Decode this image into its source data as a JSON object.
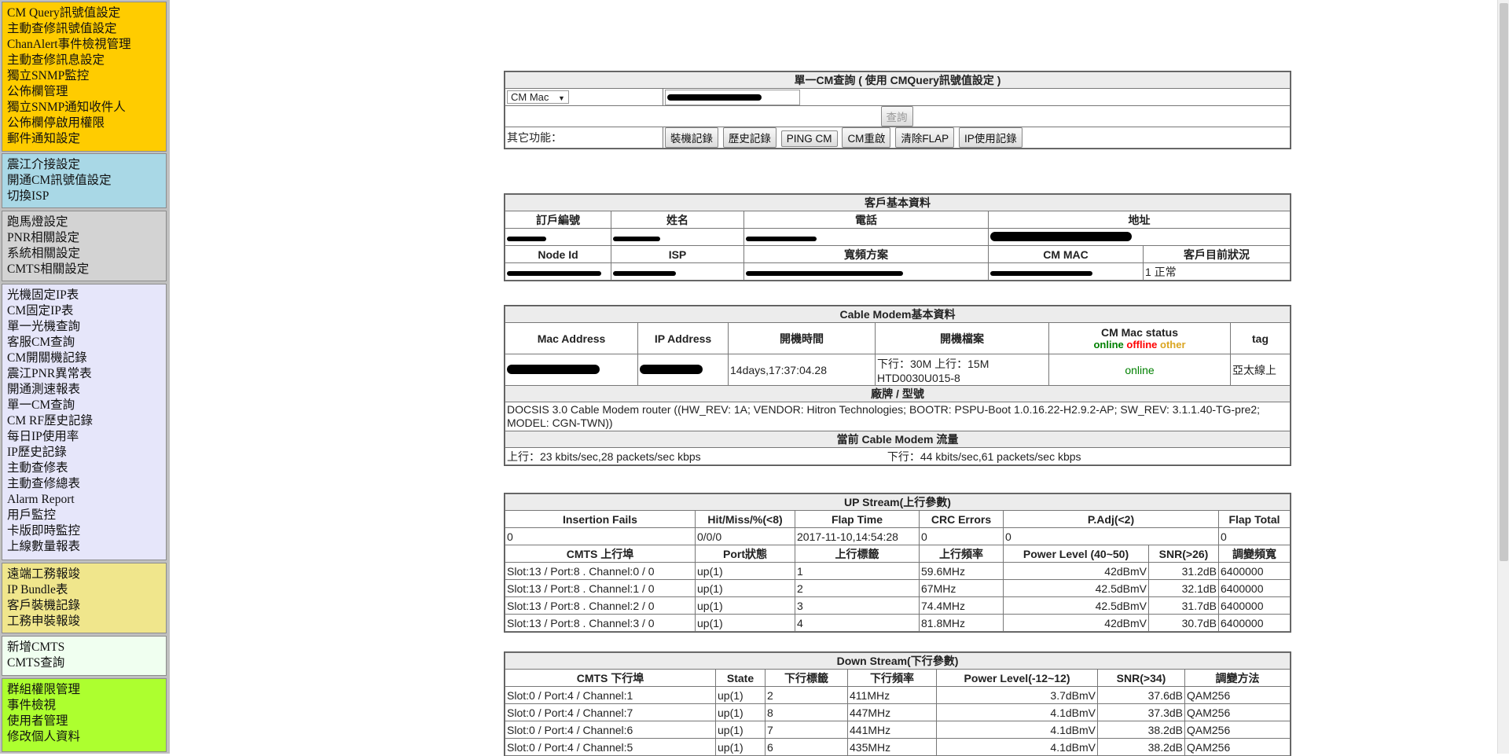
{
  "sidebar": {
    "groups": [
      {
        "items": [
          "CM Query訊號值設定",
          "主動查修訊號值設定",
          "ChanAlert事件檢視管理",
          "主動查修訊息設定",
          "獨立SNMP監控",
          "公佈欄管理",
          "獨立SNMP通知收件人",
          "公佈欄停啟用權限",
          "郵件通知設定"
        ]
      },
      {
        "items": [
          "震江介接設定",
          "開通CM訊號值設定",
          "切換ISP"
        ]
      },
      {
        "items": [
          "跑馬燈設定",
          "PNR相關設定",
          "系統相關設定",
          "CMTS相關設定"
        ]
      },
      {
        "items": [
          "光機固定IP表",
          "CM固定IP表",
          "單一光機查詢",
          "客服CM查詢",
          "CM開關機記錄",
          "震江PNR異常表",
          "開通測速報表",
          "單一CM查詢",
          "CM RF歷史記錄",
          "每日IP使用率",
          "IP歷史記錄",
          "主動查修表",
          "主動查修總表",
          "Alarm Report",
          "用戶監控",
          "卡版即時監控",
          "上線數量報表"
        ]
      },
      {
        "items": [
          "遠端工務報竣",
          "IP Bundle表",
          "客戶裝機記錄",
          "工務申裝報竣"
        ]
      },
      {
        "items": [
          "新增CMTS",
          "CMTS查詢"
        ]
      },
      {
        "items": [
          "群組權限管理",
          "事件檢視",
          "使用者管理",
          "修改個人資料"
        ]
      }
    ]
  },
  "query": {
    "title": "單一CM查詢 ( 使用 CMQuery訊號值設定 )",
    "select_value": "CM Mac",
    "search_button": "查詢",
    "other_label": "其它功能：",
    "buttons": [
      "裝機記錄",
      "歷史記錄",
      "PING CM",
      "CM重啟",
      "清除FLAP",
      "IP使用記錄"
    ]
  },
  "customer": {
    "title": "客戶基本資料",
    "headers1": [
      "訂戶編號",
      "姓名",
      "電話",
      "地址"
    ],
    "headers2": [
      "Node Id",
      "ISP",
      "寬頻方案",
      "CM MAC",
      "客戶目前狀況"
    ],
    "status": "1 正常"
  },
  "modem": {
    "title": "Cable Modem基本資料",
    "headers": [
      "Mac Address",
      "IP Address",
      "開機時間",
      "開機檔案",
      "CM Mac status",
      "tag"
    ],
    "legend": {
      "online": "online",
      "offline": "offline",
      "other": "other"
    },
    "uptime": "14days,17:37:04.28",
    "boot_file_1": "下行：30M 上行：15M",
    "boot_file_2": "HTD0030U015-8",
    "status": "online",
    "tag": "亞太線上",
    "brand_title": "廠牌 / 型號",
    "brand": "DOCSIS 3.0 Cable Modem router ((HW_REV: 1A; VENDOR: Hitron Technologies; BOOTR: PSPU-Boot 1.0.16.22-H2.9.2-AP; SW_REV: 3.1.1.40-TG-pre2; MODEL: CGN-TWN))",
    "traffic_title": "當前 Cable Modem 流量",
    "traffic_up": "上行：23 kbits/sec,28 packets/sec kbps",
    "traffic_down": "下行：44 kbits/sec,61 packets/sec kbps"
  },
  "upstream": {
    "title": "UP Stream(上行參數)",
    "headers1": [
      "Insertion Fails",
      "Hit/Miss/%(<8)",
      "Flap Time",
      "CRC Errors",
      "P.Adj(<2)",
      "Flap Total"
    ],
    "values1": [
      "0",
      "0/0/0",
      "2017-11-10,14:54:28",
      "0",
      "0",
      "0"
    ],
    "headers2": [
      "CMTS 上行埠",
      "Port狀態",
      "上行標籤",
      "上行頻率",
      "Power Level (40~50)",
      "SNR(>26)",
      "調變頻寬"
    ],
    "rows": [
      [
        "Slot:13 / Port:8 . Channel:0 / 0",
        "up(1)",
        "1",
        "59.6MHz",
        "42dBmV",
        "31.2dB",
        "6400000"
      ],
      [
        "Slot:13 / Port:8 . Channel:1 / 0",
        "up(1)",
        "2",
        "67MHz",
        "42.5dBmV",
        "32.1dB",
        "6400000"
      ],
      [
        "Slot:13 / Port:8 . Channel:2 / 0",
        "up(1)",
        "3",
        "74.4MHz",
        "42.5dBmV",
        "31.7dB",
        "6400000"
      ],
      [
        "Slot:13 / Port:8 . Channel:3 / 0",
        "up(1)",
        "4",
        "81.8MHz",
        "42dBmV",
        "30.7dB",
        "6400000"
      ]
    ]
  },
  "downstream": {
    "title": "Down Stream(下行參數)",
    "headers": [
      "CMTS 下行埠",
      "State",
      "下行標籤",
      "下行頻率",
      "Power Level(-12~12)",
      "SNR(>34)",
      "調變方法"
    ],
    "rows": [
      [
        "Slot:0 / Port:4 / Channel:1",
        "up(1)",
        "2",
        "411MHz",
        "3.7dBmV",
        "37.6dB",
        "QAM256"
      ],
      [
        "Slot:0 / Port:4 / Channel:7",
        "up(1)",
        "8",
        "447MHz",
        "4.1dBmV",
        "37.3dB",
        "QAM256"
      ],
      [
        "Slot:0 / Port:4 / Channel:6",
        "up(1)",
        "7",
        "441MHz",
        "4.1dBmV",
        "38.2dB",
        "QAM256"
      ],
      [
        "Slot:0 / Port:4 / Channel:5",
        "up(1)",
        "6",
        "435MHz",
        "4.1dBmV",
        "38.2dB",
        "QAM256"
      ]
    ]
  }
}
